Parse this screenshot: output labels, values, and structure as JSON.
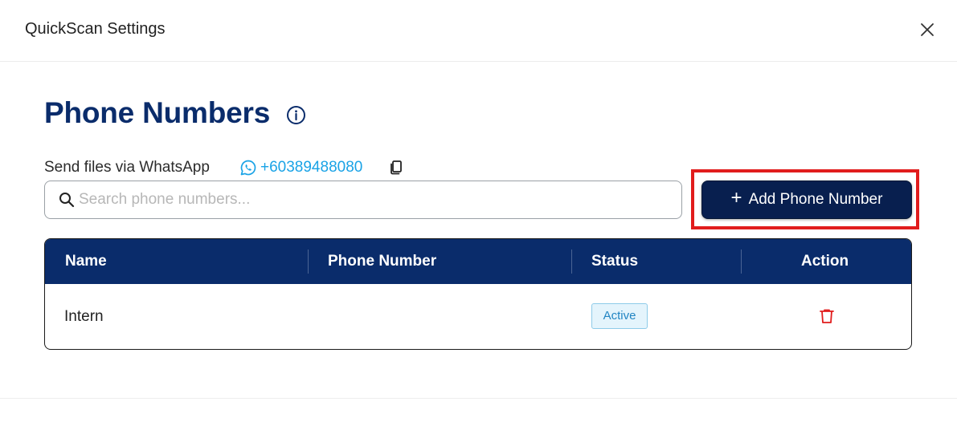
{
  "dialog": {
    "title": "QuickScan Settings"
  },
  "page": {
    "title": "Phone Numbers"
  },
  "whatsapp": {
    "label": "Send files via WhatsApp",
    "number": "+60389488080"
  },
  "search": {
    "placeholder": "Search phone numbers...",
    "value": ""
  },
  "actions": {
    "add_label": "Add Phone Number"
  },
  "table": {
    "columns": [
      "Name",
      "Phone Number",
      "Status",
      "Action"
    ],
    "rows": [
      {
        "name": "Intern",
        "phone": "",
        "status": "Active"
      }
    ]
  },
  "icons": {
    "close": "close-icon",
    "info": "info-icon",
    "whatsapp": "whatsapp-icon",
    "copy": "copy-icon",
    "search": "search-icon",
    "add": "plus-icon",
    "delete": "trash-icon"
  },
  "colors": {
    "primary": "#0a2c6b",
    "button": "#081f4f",
    "whatsapp_link": "#1aa3e6",
    "status_active_bg": "#e4f4fc",
    "status_active_text": "#2285c3",
    "delete": "#e11c1c",
    "highlight": "#e11c1c"
  }
}
